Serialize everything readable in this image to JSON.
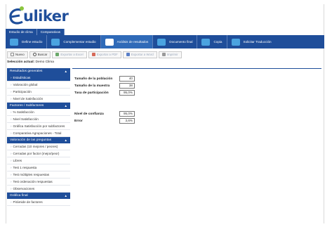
{
  "app": {
    "logo_text": "uliker",
    "logo_letter": "E"
  },
  "topnav": [
    "Estudio de clima",
    "Comparativas"
  ],
  "toolbar": [
    {
      "label": "Define estudio",
      "icon": "pencil-icon",
      "color": "#4aa3e0"
    },
    {
      "label": "Complementar estudio",
      "icon": "wand-icon",
      "color": "#4aa3e0"
    },
    {
      "label": "Análisis de resultados",
      "icon": "chart-icon",
      "color": "#ffffff"
    },
    {
      "label": "Documento final",
      "icon": "document-icon",
      "color": "#4aa3e0"
    },
    {
      "label": "Copia",
      "icon": "copy-icon",
      "color": "#4aa3e0"
    },
    {
      "label": "Solicitar Traducción",
      "icon": "translate-icon",
      "color": "#4aa3e0"
    }
  ],
  "subbar": [
    {
      "label": "Nuevo",
      "icon": "new-icon",
      "enabled": true
    },
    {
      "label": "Buscar",
      "icon": "search-icon",
      "enabled": true
    },
    {
      "label": "Exportar a Excel",
      "icon": "excel-icon",
      "enabled": false
    },
    {
      "label": "Exportar a PDF",
      "icon": "pdf-icon",
      "enabled": false
    },
    {
      "label": "Exportar a Word",
      "icon": "word-icon",
      "enabled": false
    },
    {
      "label": "Imprimir",
      "icon": "print-icon",
      "enabled": false
    }
  ],
  "selection": {
    "label": "Selección actual:",
    "value": "Demo Clima"
  },
  "sidebar": [
    {
      "header": "Resultados generales",
      "items": [
        "Estadísticas",
        "Valoración global",
        "Participación",
        "Nivel de Satisfacción"
      ],
      "active": 0
    },
    {
      "header": "Factores / Subfactores",
      "items": [
        "% Satisfacción",
        "Nivel Satisfacción",
        "Gráfica Satisfacción por subfactores",
        "Comparativa Agrupaciones - Total"
      ],
      "active": -1
    },
    {
      "header": "Valoración de las preguntas",
      "items": [
        "Cerradas (10 mejores / peores)",
        "Cerradas por factor (mejor/peor)",
        "Libres",
        "Test 1 respuesta",
        "Test múltiples respuestas",
        "Test ordenación respuestas",
        "Observaciones"
      ],
      "active": -1
    },
    {
      "header": "Gráfica final",
      "items": [
        "Pirámide de factores"
      ],
      "active": -1
    }
  ],
  "stats": {
    "poblacion_label": "Tamaño de la población",
    "poblacion_value": "40",
    "muestra_label": "Tamaño de la muestra",
    "muestra_value": "38",
    "participacion_label": "Tasa de participación",
    "participacion_value": "95,0%",
    "confianza_label": "Nivel de confianza",
    "confianza_value": "95,0%",
    "error_label": "Error",
    "error_value": "3,6%"
  },
  "colors": {
    "brand_blue": "#1f4e9a",
    "active_blue": "#2f6ab8"
  }
}
